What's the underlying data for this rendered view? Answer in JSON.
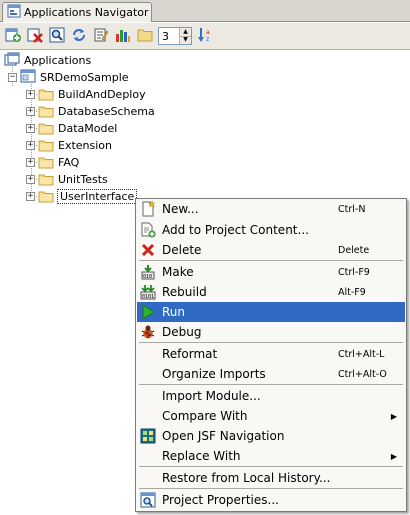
{
  "window": {
    "tab_title": "Applications Navigator",
    "tab_icon": "applications-navigator-icon"
  },
  "toolbar": {
    "buttons": [
      {
        "name": "new-application-button",
        "icon": "new-application-icon"
      },
      {
        "name": "remove-button",
        "icon": "delete-x-icon"
      },
      {
        "name": "find-button",
        "icon": "find-icon"
      },
      {
        "name": "refresh-button",
        "icon": "refresh-icon"
      },
      {
        "name": "edit-properties-button",
        "icon": "properties-icon"
      },
      {
        "name": "statistics-button",
        "icon": "bar-chart-icon"
      },
      {
        "name": "open-folder-button",
        "icon": "folder-icon"
      }
    ],
    "level_value": "3",
    "sort_icon": "sort-az-icon"
  },
  "tree": {
    "root_label": "Applications",
    "app_label": "SRDemoSample",
    "projects": [
      "BuildAndDeploy",
      "DatabaseSchema",
      "DataModel",
      "Extension",
      "FAQ",
      "UnitTests",
      "UserInterface"
    ],
    "selected": "UserInterface",
    "expand_collapsed": "+",
    "expand_expanded": "−"
  },
  "menu": {
    "items": [
      {
        "label": "New...",
        "accel": "Ctrl-N",
        "icon": "new-file-icon"
      },
      {
        "label": "Add to Project Content...",
        "accel": "",
        "icon": "add-content-icon"
      },
      {
        "label": "Delete",
        "accel": "Delete",
        "icon": "delete-x-icon"
      },
      {
        "label": "Make",
        "accel": "Ctrl-F9",
        "icon": "make-icon"
      },
      {
        "label": "Rebuild",
        "accel": "Alt-F9",
        "icon": "rebuild-icon"
      },
      {
        "label": "Run",
        "accel": "",
        "icon": "run-icon",
        "highlighted": true
      },
      {
        "label": "Debug",
        "accel": "",
        "icon": "debug-bug-icon"
      },
      {
        "label": "Reformat",
        "accel": "Ctrl+Alt-L",
        "icon": ""
      },
      {
        "label": "Organize Imports",
        "accel": "Ctrl+Alt-O",
        "icon": ""
      },
      {
        "label": "Import Module...",
        "accel": "",
        "icon": ""
      },
      {
        "label": "Compare With",
        "accel": "",
        "icon": "",
        "submenu": true
      },
      {
        "label": "Open JSF Navigation",
        "accel": "",
        "icon": "jsf-navigation-icon"
      },
      {
        "label": "Replace With",
        "accel": "",
        "icon": "",
        "submenu": true
      },
      {
        "label": "Restore from Local History...",
        "accel": "",
        "icon": ""
      },
      {
        "label": "Project Properties...",
        "accel": "",
        "icon": "project-properties-icon"
      }
    ],
    "submenu_arrow": "▶"
  },
  "colors": {
    "highlight": "#316ac5",
    "folder_fill": "#f5d98a",
    "folder_border": "#c8a13a",
    "toolbar_bg": "#ece9e2",
    "menu_bg": "#f9f8f4"
  }
}
